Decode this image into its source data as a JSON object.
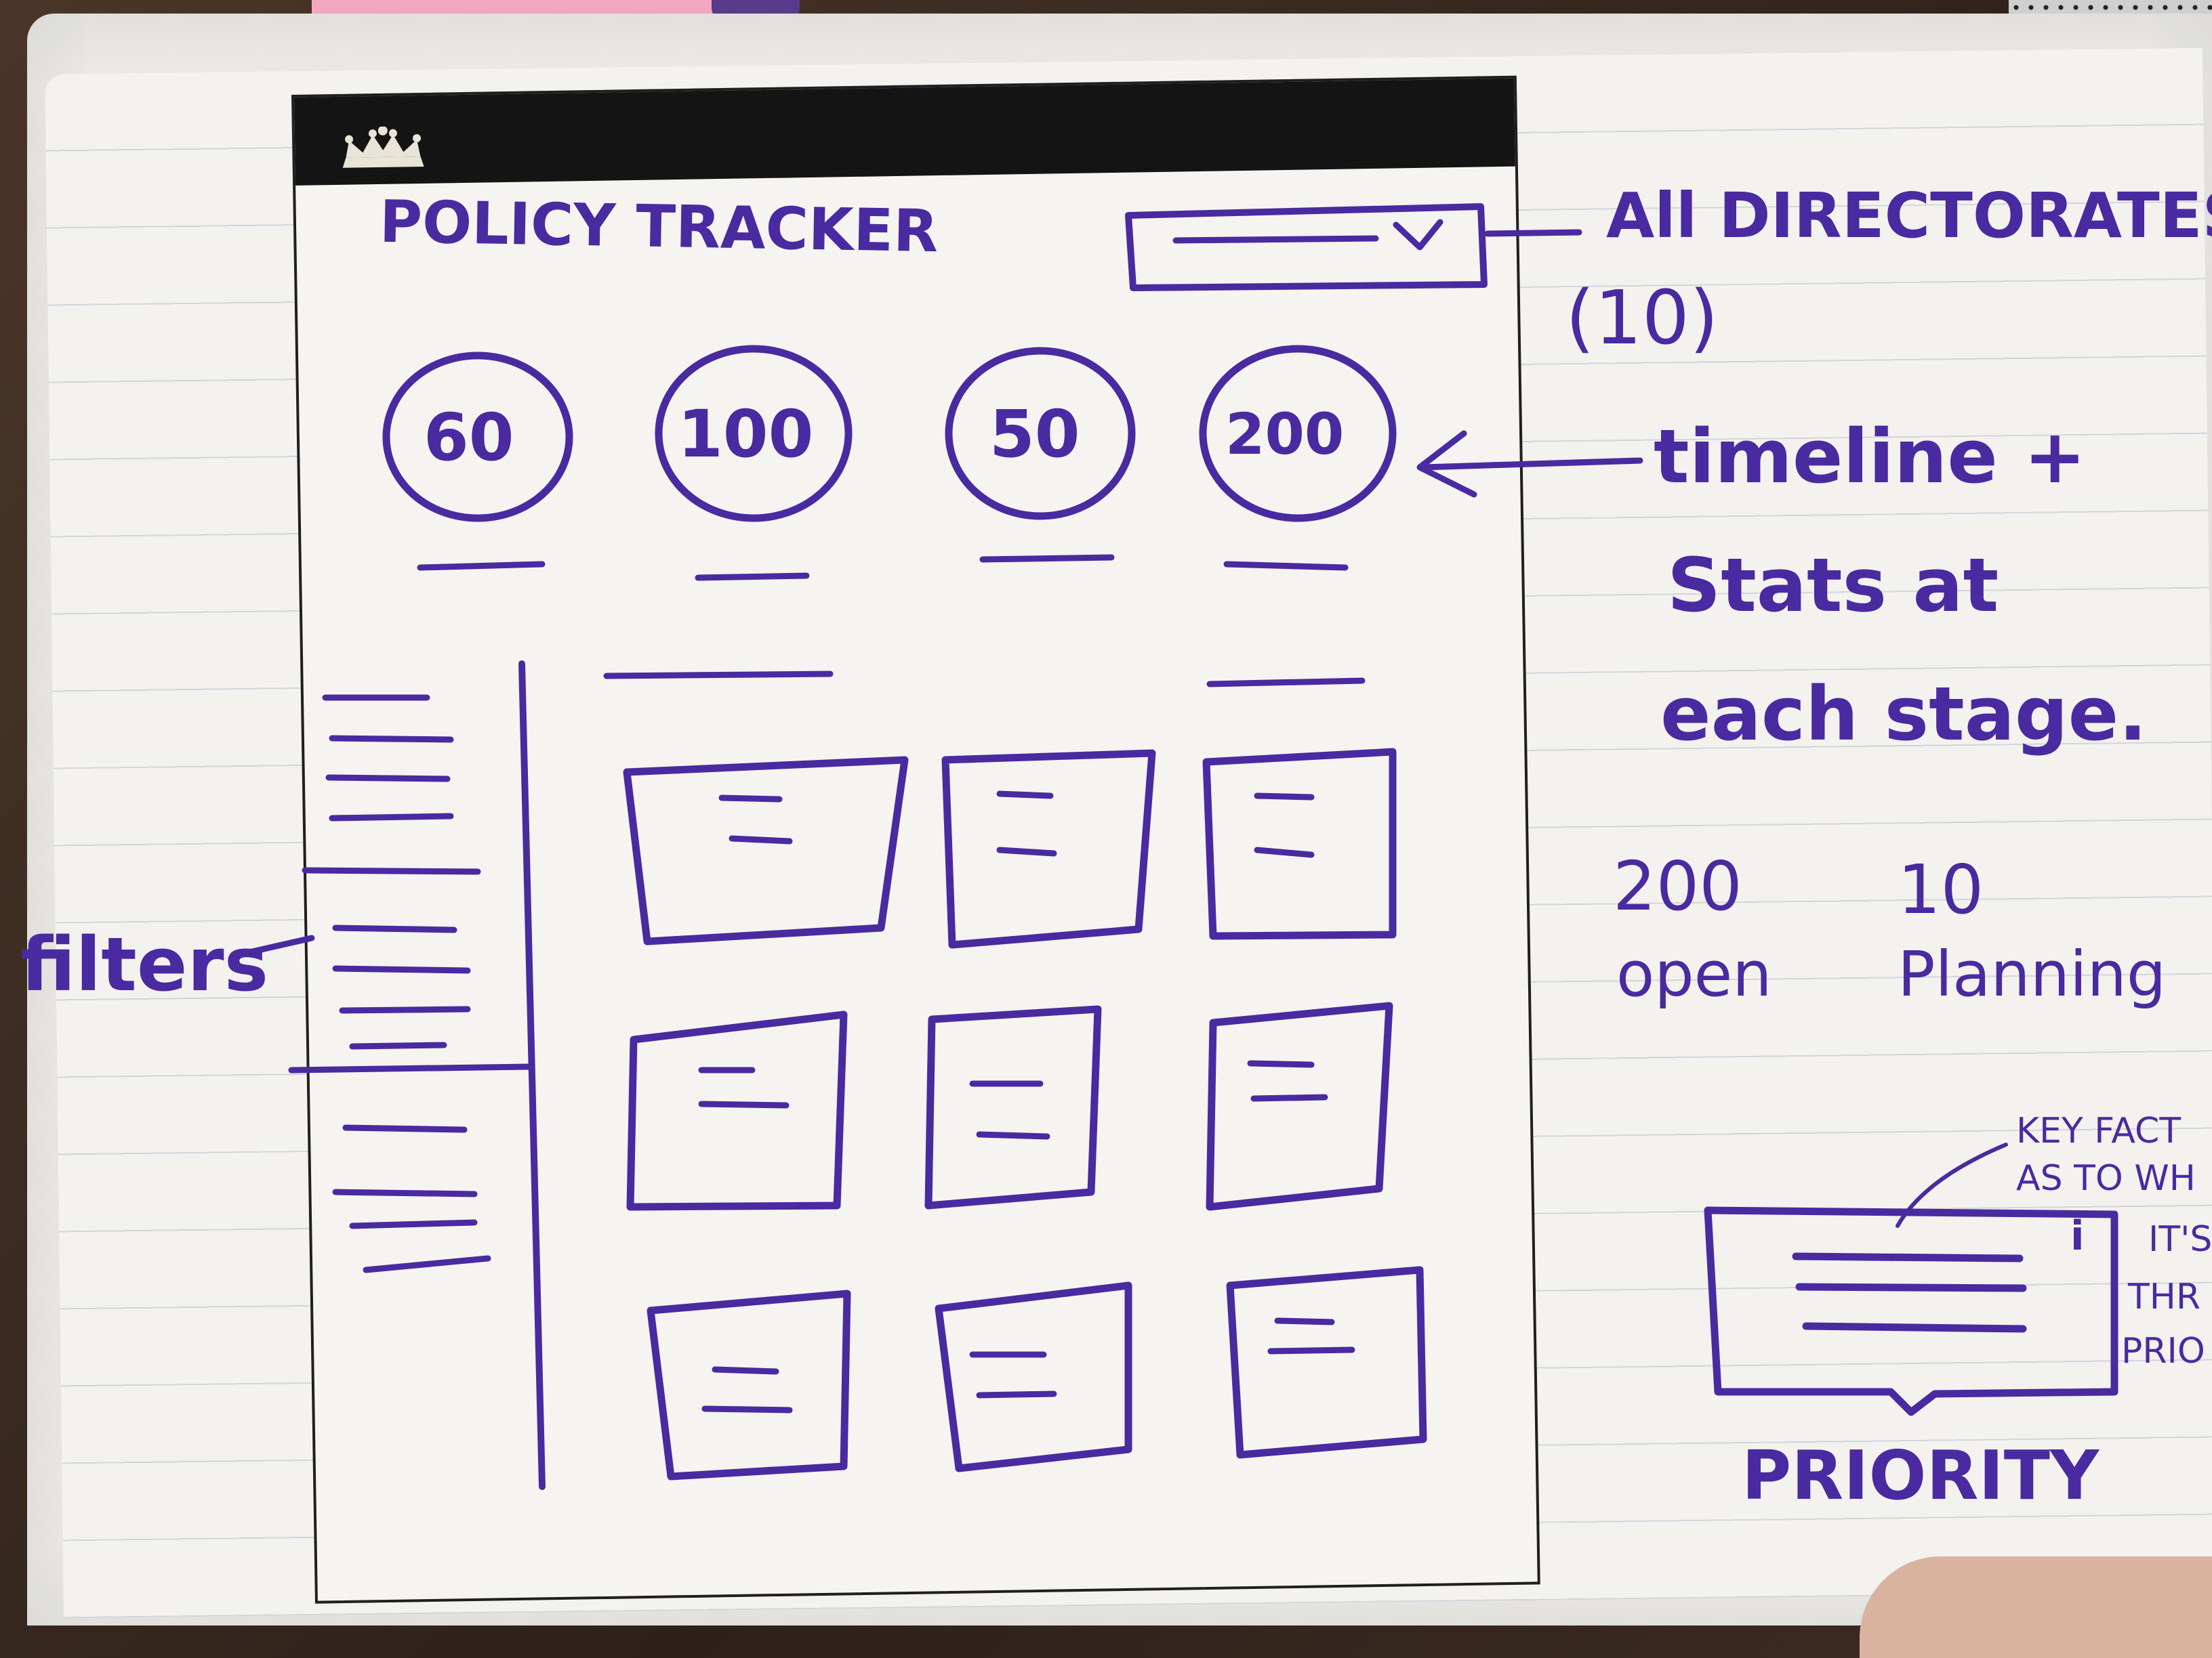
{
  "sketch": {
    "app_title": "POLICY TRACKER",
    "directorate_label": "All DIRECTORATES",
    "directorate_count": "(10)",
    "stats": [
      "60",
      "100",
      "50",
      "200"
    ],
    "stats_note_line1": "timeline +",
    "stats_note_line2": "Stats at",
    "stats_note_line3": "each stage.",
    "filters_label": "filters",
    "summary": {
      "open_value": "200",
      "open_label": "open",
      "planning_value": "10",
      "planning_label": "Planning"
    },
    "callout_line1": "KEY FACT",
    "callout_line2": "AS TO WH",
    "side_note_line1": "IT'S",
    "side_note_line2": "THR",
    "side_note_line3": "PRIO",
    "info_glyph": "i",
    "priority_label": "PRIORITY"
  },
  "colors": {
    "ink": "#4a2aa0",
    "paper": "#f3f2ee",
    "header_bar": "#141414"
  }
}
